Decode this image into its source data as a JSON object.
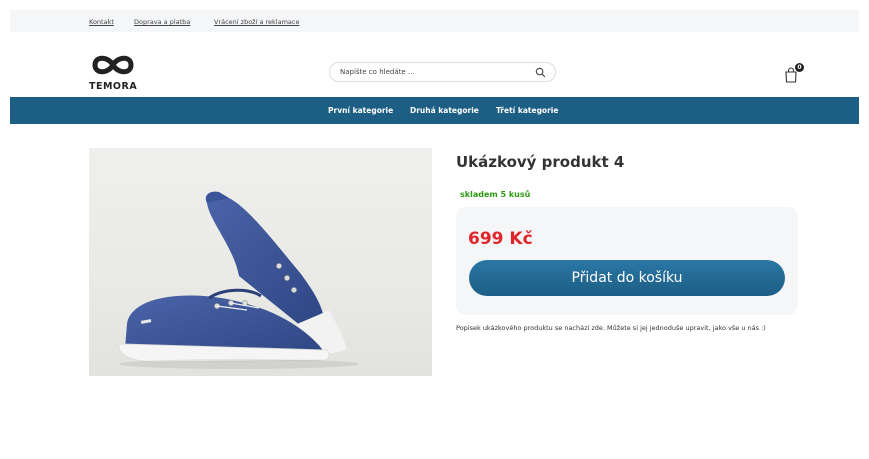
{
  "topbar": {
    "links": [
      "Kontakt",
      "Doprava a platba",
      "Vrácení zboží a reklamace"
    ]
  },
  "header": {
    "logo_text": "TEMORA",
    "search": {
      "placeholder": "Napište co hledáte ...",
      "icon": "search-icon"
    },
    "cart": {
      "icon": "shopping-bag-icon",
      "count": "0"
    }
  },
  "nav": {
    "items": [
      "První kategorie",
      "Druhá kategorie",
      "Třetí kategorie"
    ],
    "background": "#1d5e84"
  },
  "product": {
    "title": "Ukázkový produkt 4",
    "stock": "skladem 5 kusů",
    "price": "699 Kč",
    "add_button": "Přidat do košíku",
    "description": "Popisek ukázkového produktu se nachází zde. Můžete si jej jednoduše upravit, jako vše u nás :)",
    "image": "blue-canvas-sneakers-photo"
  },
  "colors": {
    "accent": "#1d5e84",
    "price": "#e0262a",
    "stock": "#2e9a13"
  }
}
